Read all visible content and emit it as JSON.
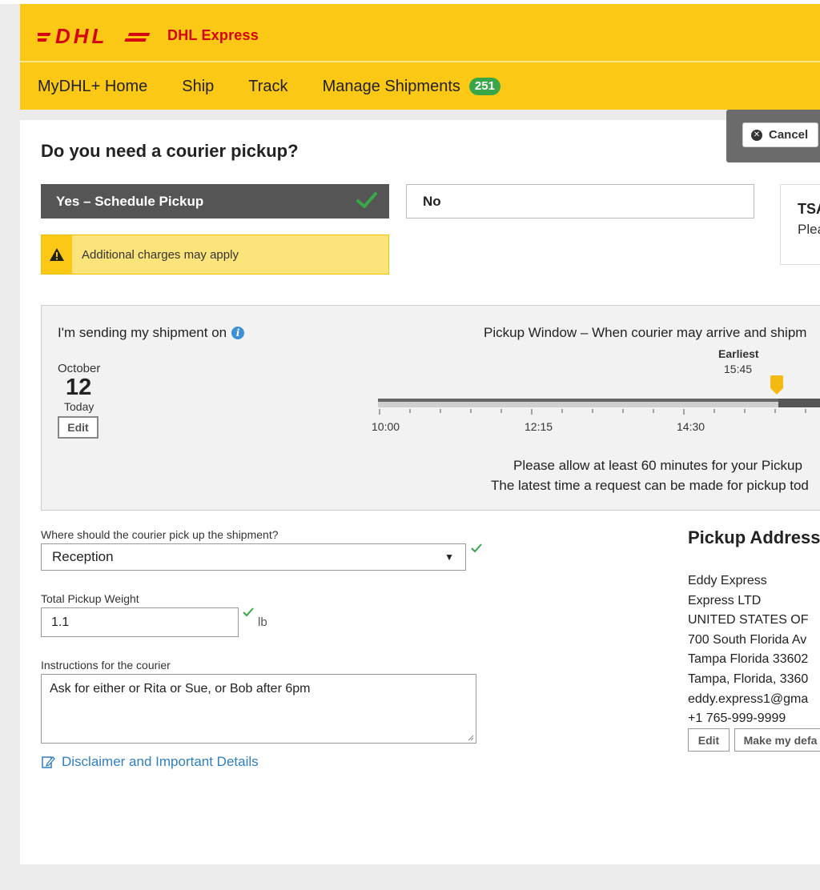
{
  "header": {
    "brand_name": "DHL Express",
    "logo_text": "DHL",
    "brand_color": "#fcc816",
    "logo_color": "#d40511",
    "nav": [
      {
        "label": "MyDHL+ Home"
      },
      {
        "label": "Ship"
      },
      {
        "label": "Track"
      },
      {
        "label": "Manage Shipments",
        "badge": "251"
      }
    ]
  },
  "cancel": {
    "label": "Cancel",
    "icon": "close-circle-icon"
  },
  "pickup_question": {
    "title": "Do you need a courier pickup?",
    "yes_label": "Yes – Schedule Pickup",
    "yes_selected": true,
    "no_label": "No",
    "tsa_title": "TSA",
    "tsa_text": "Plea"
  },
  "warning": {
    "text": "Additional charges may apply",
    "icon": "warning-triangle-icon"
  },
  "shipment_date": {
    "label": "I'm sending my shipment on",
    "month": "October",
    "day": "12",
    "relative": "Today",
    "edit_label": "Edit"
  },
  "pickup_window": {
    "title": "Pickup Window – When courier may arrive and shipm",
    "earliest_label": "Earliest",
    "earliest_time": "15:45",
    "ticks": [
      "10:00",
      "12:15",
      "14:30"
    ],
    "allow_text": "Please allow at least 60 minutes for your Pickup",
    "latest_text": "The latest time a request can be made for pickup tod"
  },
  "form": {
    "location_label": "Where should the courier pick up the shipment?",
    "location_value": "Reception",
    "weight_label": "Total Pickup Weight",
    "weight_value": "1.1",
    "weight_unit": "lb",
    "instructions_label": "Instructions for the courier",
    "instructions_value": "Ask for either or Rita or Sue, or Bob after 6pm",
    "disclaimer_link": "Disclaimer and Important Details"
  },
  "pickup_address": {
    "title": "Pickup Address",
    "lines": [
      "Eddy Express",
      "Express LTD",
      "UNITED STATES OF",
      "700 South Florida Av",
      "Tampa Florida 33602",
      "Tampa, Florida, 3360",
      "eddy.express1@gma",
      "+1 765-999-9999"
    ],
    "edit_label": "Edit",
    "default_label": "Make my defa"
  }
}
